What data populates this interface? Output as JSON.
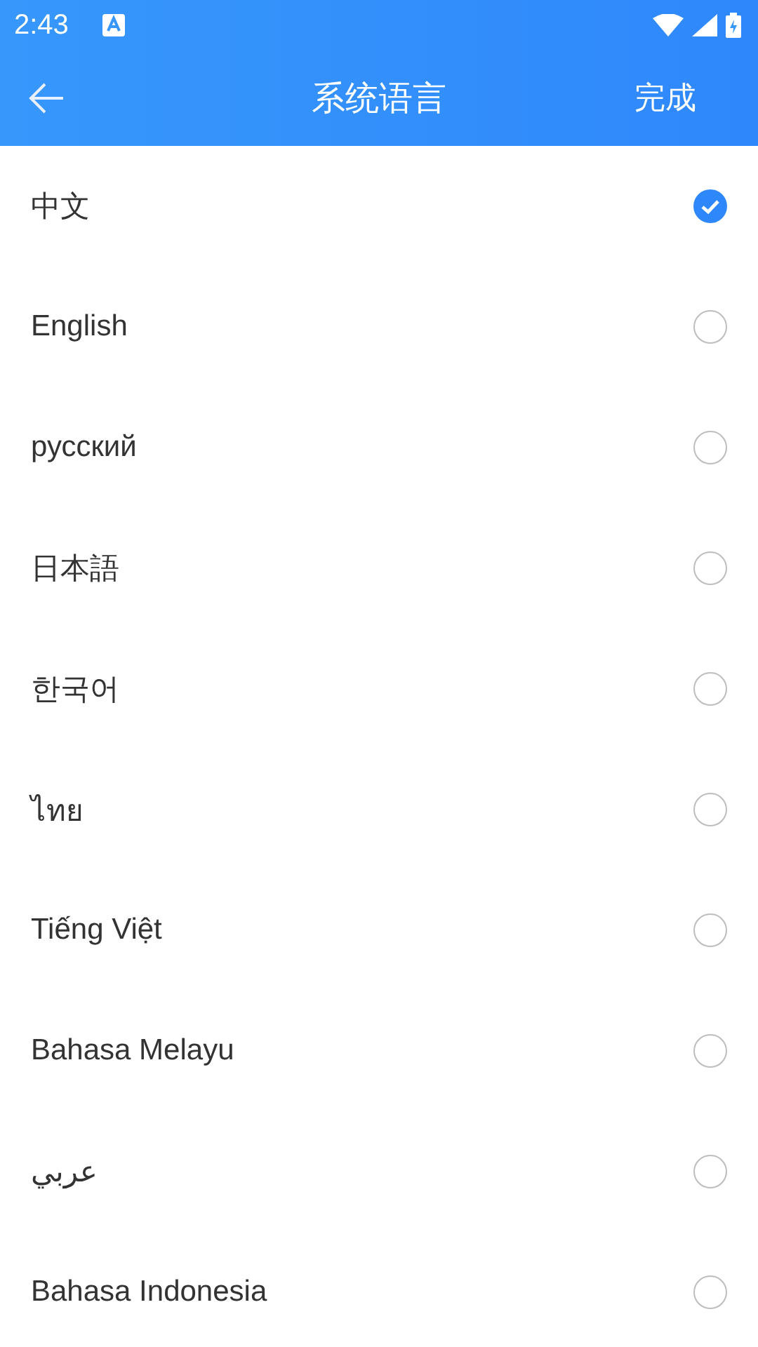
{
  "status_bar": {
    "time": "2:43"
  },
  "header": {
    "title": "系统语言",
    "action": "完成"
  },
  "languages": [
    {
      "label": "中文",
      "selected": true
    },
    {
      "label": "English",
      "selected": false
    },
    {
      "label": "русский",
      "selected": false
    },
    {
      "label": "日本語",
      "selected": false
    },
    {
      "label": "한국어",
      "selected": false
    },
    {
      "label": "ไทย",
      "selected": false
    },
    {
      "label": "Tiếng Việt",
      "selected": false
    },
    {
      "label": "Bahasa Melayu",
      "selected": false
    },
    {
      "label": "عربي",
      "selected": false
    },
    {
      "label": "Bahasa Indonesia",
      "selected": false
    }
  ]
}
